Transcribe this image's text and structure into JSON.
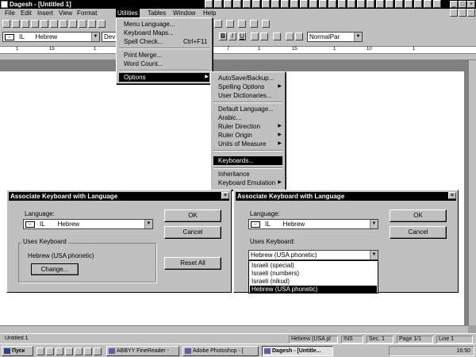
{
  "window": {
    "title": "Dagesh - [Untitled 1]"
  },
  "menubar": {
    "items": [
      "File",
      "Edit",
      "Insert",
      "View",
      "Format",
      "Utilities",
      "Tables",
      "Window",
      "Help"
    ],
    "selected": "Utilities"
  },
  "format_bar": {
    "language_code": "IL",
    "language": "Hebrew",
    "font": "Dev",
    "style": "NormalPar",
    "bold": "B",
    "italic": "I",
    "underline": "U"
  },
  "ruler": {
    "numbers": [
      "1",
      "15",
      "1",
      "7",
      "1",
      "15",
      "1",
      "10",
      "1"
    ]
  },
  "utilities_menu": {
    "items": [
      {
        "label": "Menu Language..."
      },
      {
        "label": "Keyboard Maps..."
      },
      {
        "label": "Spell Check...",
        "shortcut": "Ctrl+F11"
      },
      {
        "label": "Print Merge..."
      },
      {
        "label": "Word Count..."
      },
      {
        "label": "Options"
      }
    ]
  },
  "options_menu": {
    "items": [
      {
        "label": "AutoSave/Backup..."
      },
      {
        "label": "Spelling Options"
      },
      {
        "label": "User Dictionaries..."
      },
      {
        "label": "Default Language..."
      },
      {
        "label": "Arabic..."
      },
      {
        "label": "Ruler Direction"
      },
      {
        "label": "Ruler Origin"
      },
      {
        "label": "Units of Measure"
      },
      {
        "label": "Keyboards..."
      },
      {
        "label": "Inheritance"
      },
      {
        "label": "Keyboard Emulation"
      }
    ]
  },
  "dialog_left": {
    "title": "Associate Keyboard with Language",
    "language_label": "Language:",
    "language_code": "IL",
    "language_value": "Hebrew",
    "uses_label": "Uses Keyboard",
    "keyboard_value": "Hebrew (USA phonetic)",
    "change_label": "Change...",
    "ok_label": "OK",
    "cancel_label": "Cancel",
    "reset_label": "Reset All"
  },
  "dialog_right": {
    "title": "Associate Keyboard with Language",
    "language_label": "Language:",
    "language_code": "IL",
    "language_value": "Hebrew",
    "uses_label": "Uses Keyboard:",
    "keyboard_value": "Hebrew (USA phonetic)",
    "options": [
      "Israeli (special)",
      "Israeli (numbers)",
      "Israeli (nikud)",
      "Hebrew (USA phonetic)"
    ],
    "ok_label": "OK",
    "cancel_label": "Cancel"
  },
  "status": {
    "page_name": "Untitled 1",
    "language": "Hebrew (USA pl",
    "ins": "INS",
    "section": "Sec. 1",
    "page": "Page 1/1",
    "line": "Line 1"
  },
  "taskbar": {
    "start": "Пуск",
    "tasks": [
      "ABBYY FineReader -",
      "Adobe Photoshop - [",
      "Dagesh - [Untitle..."
    ],
    "clock": "16:50"
  }
}
